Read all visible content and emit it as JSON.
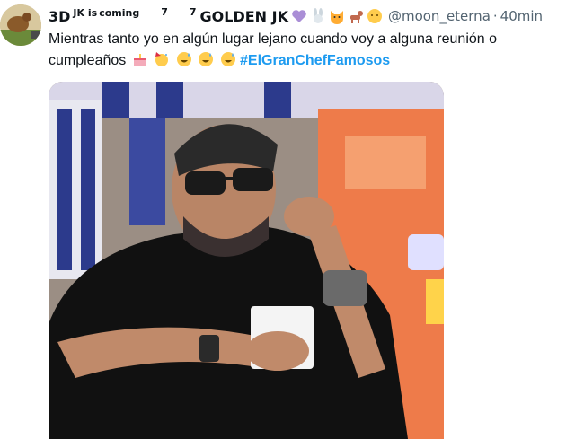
{
  "tweet": {
    "name_parts": {
      "a": "3D",
      "b": "JK is",
      "c": "coming",
      "d": "7",
      "e": "7",
      "f": "GOLDEN JK"
    },
    "handle": "@moon_eterna",
    "separator": "·",
    "time": "40min",
    "text": "Mientras tanto yo  en algún lugar lejano cuando voy a alguna reunión o cumpleaños",
    "hashtag": "#ElGranChefFamosos",
    "name_emojis": [
      "purple-heart",
      "rabbit",
      "cat",
      "dog",
      "emoji-face"
    ],
    "text_emojis": [
      "birthday-cake",
      "party-face",
      "sweat-smile",
      "sweat-smile",
      "sweat-smile"
    ]
  },
  "colors": {
    "link": "#1d9bf0",
    "muted": "#536471",
    "text": "#0f1419"
  }
}
